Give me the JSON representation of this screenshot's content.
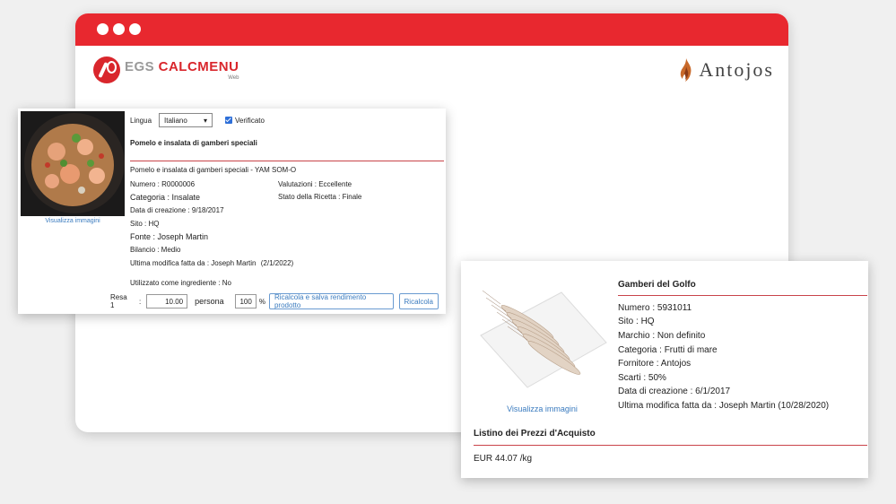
{
  "brand": {
    "egs": "EGS",
    "calcmenu": "CALCMENU",
    "web": "Web",
    "client": "Antojos"
  },
  "recipe": {
    "language_label": "Lingua",
    "language_value": "Italiano",
    "verified_label": "Verificato",
    "title": "Pomelo e insalata di gamberi speciali",
    "subtitle": "Pomelo e insalata di gamberi speciali - YAM SOM-O",
    "view_images": "Visualizza immagini",
    "numero": "Numero : R0000006",
    "valutazioni": "Valutazioni : Eccellente",
    "categoria": "Categoria :  Insalate",
    "stato": "Stato della Ricetta : Finale",
    "data_creazione": "Data di creazione : 9/18/2017",
    "sito": "Sito : HQ",
    "fonte": "Fonte : Joseph Martin",
    "bilancio": "Bilancio : Medio",
    "ultima_modifica": "Ultima modifica fatta da : Joseph Martin",
    "ultima_modifica_date": "(2/1/2022)",
    "utilizzato": "Utilizzato come ingrediente : No",
    "resa_label": "Resa 1",
    "resa_colon": ":",
    "resa_value": "10.00",
    "persona": "persona",
    "percent_value": "100",
    "percent_sign": "%",
    "btn_recalc_save": "Ricalcola e salva rendimento prodotto",
    "btn_recalc": "Ricalcola"
  },
  "ingredient": {
    "title": "Gamberi del Golfo",
    "view_images": "Visualizza immagini",
    "numero": "Numero : 5931011",
    "sito": "Sito : HQ",
    "marchio": "Marchio : Non definito",
    "categoria": "Categoria : Frutti di mare",
    "fornitore": "Fornitore : Antojos",
    "scarti": "Scarti : 50%",
    "data_creazione": "Data di creazione : 6/1/2017",
    "ultima_modifica": "Ultima modifica fatta da : Joseph Martin (10/28/2020)",
    "listino_title": "Listino dei Prezzi d'Acquisto",
    "price": "EUR 44.07 /kg"
  },
  "colors": {
    "accent_red": "#e8282f",
    "link_blue": "#3a7bbf"
  }
}
